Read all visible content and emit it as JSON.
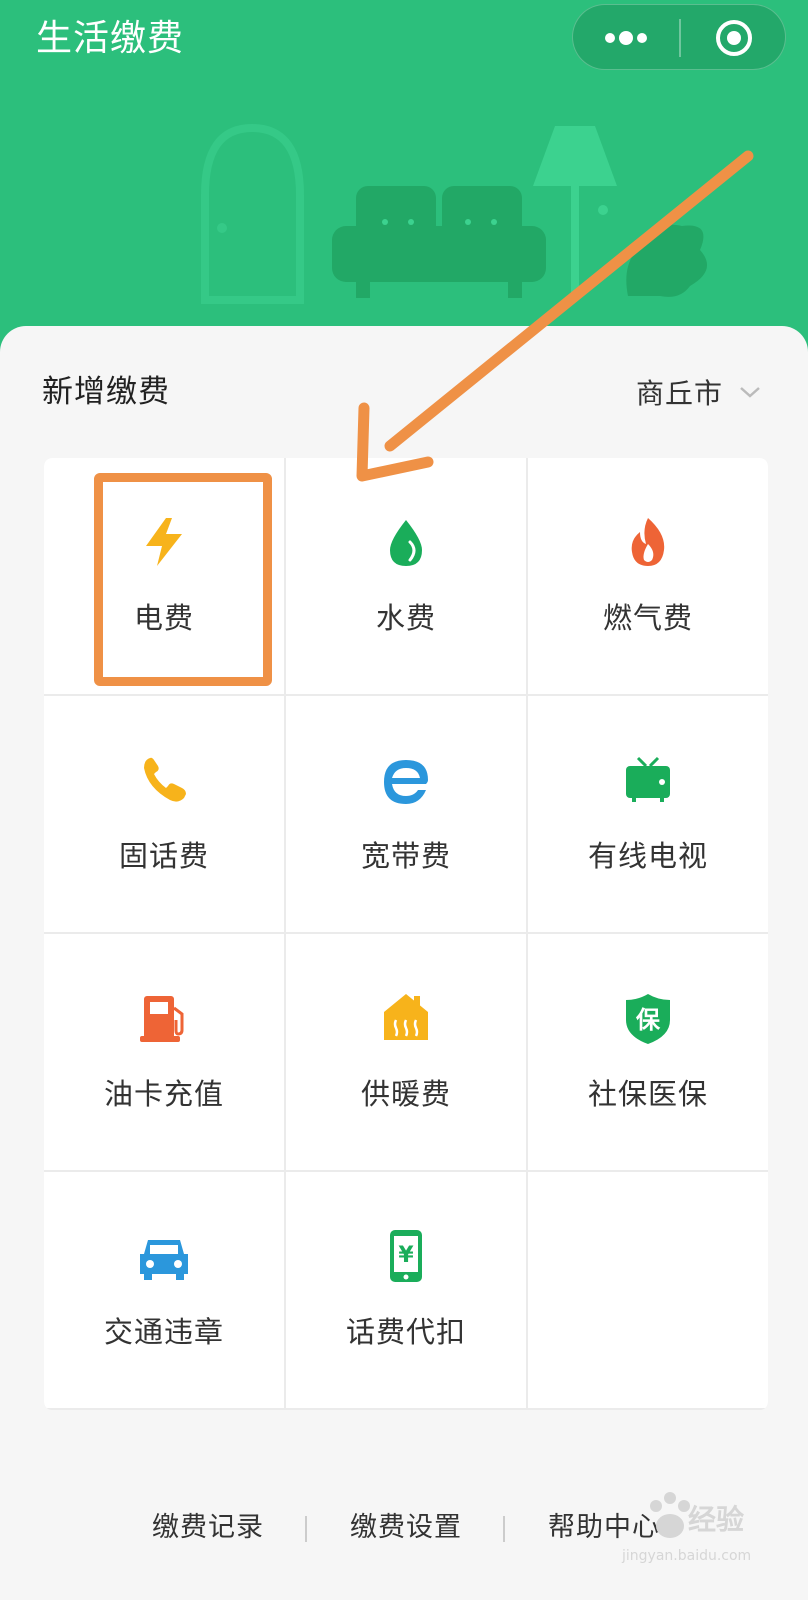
{
  "header": {
    "title": "生活缴费",
    "accent_color": "#2cbf7c",
    "more_icon": "more-dots-icon",
    "close_icon": "target-circle-icon"
  },
  "section": {
    "title": "新增缴费",
    "city": "商丘市",
    "city_icon": "chevron-down-icon"
  },
  "services": [
    {
      "label": "电费",
      "icon": "lightning-icon",
      "color": "#f7b31b"
    },
    {
      "label": "水费",
      "icon": "water-drop-icon",
      "color": "#1aad5a"
    },
    {
      "label": "燃气费",
      "icon": "flame-icon",
      "color": "#ee6436"
    },
    {
      "label": "固话费",
      "icon": "phone-icon",
      "color": "#f7b31b"
    },
    {
      "label": "宽带费",
      "icon": "broadband-e-icon",
      "color": "#2b97dc"
    },
    {
      "label": "有线电视",
      "icon": "tv-icon",
      "color": "#1aad5a"
    },
    {
      "label": "油卡充值",
      "icon": "gas-pump-icon",
      "color": "#ee6436"
    },
    {
      "label": "供暖费",
      "icon": "heating-house-icon",
      "color": "#f7b31b"
    },
    {
      "label": "社保医保",
      "icon": "insurance-shield-icon",
      "color": "#1aad5a",
      "glyph": "保"
    },
    {
      "label": "交通违章",
      "icon": "car-icon",
      "color": "#2b97dc"
    },
    {
      "label": "话费代扣",
      "icon": "mobile-yuan-icon",
      "color": "#1aad5a",
      "glyph": "¥"
    }
  ],
  "footer": {
    "links": [
      "缴费记录",
      "缴费设置",
      "帮助中心"
    ]
  },
  "watermark": {
    "brand": "Bai du",
    "text": "经验",
    "sub": "jingyan.baidu.com"
  },
  "annotation": {
    "highlight_color": "#ef9146"
  }
}
